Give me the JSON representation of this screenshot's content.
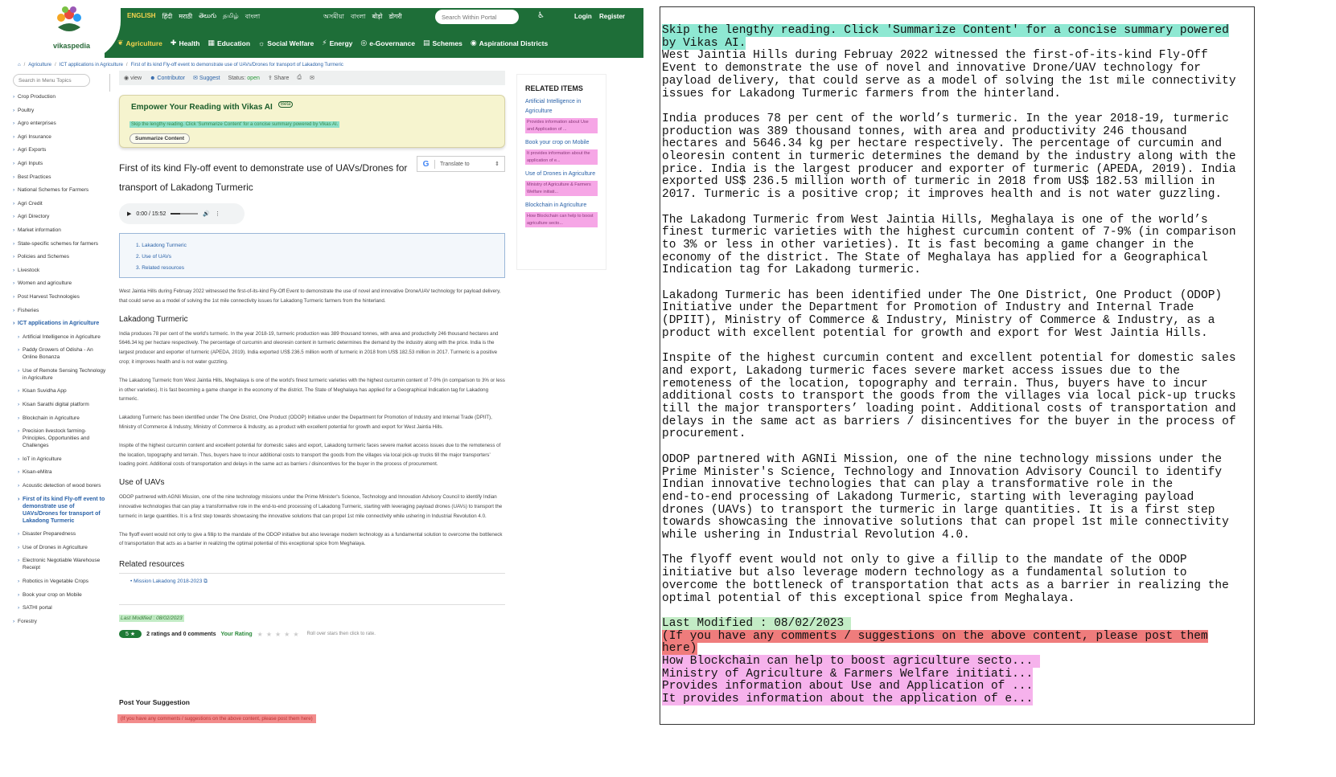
{
  "header": {
    "logo_text": "vikaspedia",
    "languages": [
      "ENGLISH",
      "हिंदी",
      "मराठी",
      "తెలుగు",
      "தமிழ்",
      "বাংলা"
    ],
    "languages2": [
      "অসমীয়া",
      "বাংলা",
      "बोड़ो",
      "डोगरी"
    ],
    "search_placeholder": "Search Within Portal",
    "login": "Login",
    "register": "Register",
    "nav": [
      {
        "label": "Agriculture",
        "icon": "plant-icon"
      },
      {
        "label": "Health",
        "icon": "health-icon"
      },
      {
        "label": "Education",
        "icon": "education-icon"
      },
      {
        "label": "Social Welfare",
        "icon": "welfare-icon"
      },
      {
        "label": "Energy",
        "icon": "energy-icon"
      },
      {
        "label": "e-Governance",
        "icon": "egov-icon"
      },
      {
        "label": "Schemes",
        "icon": "schemes-icon"
      },
      {
        "label": "Aspirational Districts",
        "icon": "location-icon"
      }
    ]
  },
  "breadcrumb": [
    "Agriculture",
    "ICT applications in Agriculture",
    "First of its kind Fly-off event to demonstrate use of UAVs/Drones for transport of Lakadong Turmeric"
  ],
  "sidebar": {
    "search_placeholder": "Search in Menu Topics",
    "items": [
      {
        "label": "Crop Production",
        "type": "top"
      },
      {
        "label": "Poultry",
        "type": "top"
      },
      {
        "label": "Agro enterprises",
        "type": "top"
      },
      {
        "label": "Agri Insurance",
        "type": "top"
      },
      {
        "label": "Agri Exports",
        "type": "top"
      },
      {
        "label": "Agri Inputs",
        "type": "top"
      },
      {
        "label": "Best Practices",
        "type": "top"
      },
      {
        "label": "National Schemes for Farmers",
        "type": "top"
      },
      {
        "label": "Agri Credit",
        "type": "top"
      },
      {
        "label": "Agri Directory",
        "type": "top"
      },
      {
        "label": "Market information",
        "type": "top"
      },
      {
        "label": "State-specific schemes for farmers",
        "type": "top"
      },
      {
        "label": "Policies and Schemes",
        "type": "top"
      },
      {
        "label": "Livestock",
        "type": "top"
      },
      {
        "label": "Women and agriculture",
        "type": "top"
      },
      {
        "label": "Post Harvest Technologies",
        "type": "top"
      },
      {
        "label": "Fisheries",
        "type": "top"
      },
      {
        "label": "ICT applications in Agriculture",
        "type": "active"
      },
      {
        "label": "Artificial Intelligence in Agriculture",
        "type": "sub"
      },
      {
        "label": "Paddy Growers of Odisha - An Online Bonanza",
        "type": "sub"
      },
      {
        "label": "Use of Remote Sensing Technology in Agriculture",
        "type": "sub"
      },
      {
        "label": "Kisan Suvidha App",
        "type": "sub"
      },
      {
        "label": "Kisan Sarathi digital platform",
        "type": "sub"
      },
      {
        "label": "Blockchain in Agriculture",
        "type": "sub"
      },
      {
        "label": "Precision livestock farming-Principles, Opportunities and Challenges",
        "type": "sub"
      },
      {
        "label": "IoT in Agriculture",
        "type": "sub"
      },
      {
        "label": "Kisan-eMitra",
        "type": "sub"
      },
      {
        "label": "Acoustic detection of wood borers",
        "type": "sub"
      },
      {
        "label": "First of its kind Fly-off event to demonstrate use of UAVs/Drones for transport of Lakadong Turmeric",
        "type": "current"
      },
      {
        "label": "Disaster Preparedness",
        "type": "sub"
      },
      {
        "label": "Use of Drones in Agriculture",
        "type": "sub"
      },
      {
        "label": "Electronic Negotiable Warehouse Receipt",
        "type": "sub"
      },
      {
        "label": "Robotics in Vegetable Crops",
        "type": "sub"
      },
      {
        "label": "Book your crop on Mobile",
        "type": "sub"
      },
      {
        "label": "SATHI portal",
        "type": "sub"
      },
      {
        "label": "Forestry",
        "type": "top"
      }
    ]
  },
  "action_bar": {
    "view": "view",
    "contributor": "Contributor",
    "suggest": "Suggest",
    "status_label": "Status:",
    "status_value": "open",
    "share": "Share"
  },
  "ai_box": {
    "title": "Empower Your Reading with Vikas AI",
    "beta": "Beta",
    "hint": "Skip the lengthy reading. Click 'Summarize Content' for a concise summary powered by Vikas AI.",
    "button": "Summarize Content"
  },
  "article": {
    "title": "First of its kind Fly-off event to demonstrate use of UAVs/Drones for transport of Lakadong Turmeric",
    "translate": "Translate to",
    "audio_time": "0:00 / 15:52",
    "toc": [
      "1. Lakadong Turmeric",
      "2. Use of UAVs",
      "3. Related resources"
    ],
    "intro": "West Jaintia Hills during Februay 2022 witnessed the first-of-its-kind Fly-Off Event to demonstrate the use of novel and innovative Drone/UAV technology for payload delivery, that could serve as a model of solving the 1st mile connectivity issues for Lakadong Turmeric farmers from the hinterland.",
    "h_turmeric": "Lakadong Turmeric",
    "p1": "India produces 78 per cent of the world’s turmeric. In the year 2018-19, turmeric production was 389 thousand tonnes, with area and productivity 246 thousand hectares and 5646.34 kg per hectare respectively. The percentage of curcumin and oleoresin content in turmeric determines the demand by the industry along with the price. India is the largest producer and exporter of turmeric (APEDA, 2019). India exported US$ 236.5 million worth of turmeric in 2018 from US$ 182.53 million in 2017. Turmeric is a positive crop; it improves health and is not water guzzling.",
    "p2": "The Lakadong Turmeric from West Jaintia Hills, Meghalaya is one of the world’s finest turmeric varieties with the highest curcumin content of 7-9% (in comparison to 3% or less in other varieties). It is fast becoming a game changer in the economy of the district. The State of Meghalaya has applied for a Geographical Indication tag for Lakadong turmeric.",
    "p3": "Lakadong Turmeric has been identified under The One District, One Product (ODOP) Initiative under the Department for Promotion of Industry and Internal Trade (DPIIT), Ministry of Commerce & Industry, Ministry of Commerce & Industry, as a product with excellent potential for growth and export for West Jaintia Hills.",
    "p4": "Inspite of the highest curcumin content and excellent potential for domestic sales and export, Lakadong turmeric faces severe market access issues due to the remoteness of the location, topography and terrain. Thus, buyers have to incur additional costs to transport the goods from the villages via local pick-up trucks till the major transporters’ loading point. Additional costs of transportation and delays in the same act as barriers / disincentives for the buyer in the process of procurement.",
    "h_uavs": "Use of UAVs",
    "p5": "ODOP partnered with AGNIi Mission, one of the nine technology missions under the Prime Minister's Science, Technology and Innovation Advisory Council to identify Indian innovative technologies that can play a transformative role in the end-to-end processing of Lakadong Turmeric, starting with leveraging payload drones (UAVs) to transport the turmeric in large quantities. It is a first step towards showcasing the innovative solutions that can propel 1st mile connectivity while ushering in Industrial Revolution 4.0.",
    "p6": "The flyoff event would not only to give a fillip to the mandate of the ODOP initiative but also leverage modern technology as a fundamental solution to overcome the bottleneck of transportation that acts as a barrier in realizing the optimal potential of this exceptional spice from Meghalaya.",
    "h_related": "Related resources",
    "related_link": "Mission Lakadong 2018-2023",
    "last_modified": "Last Modified : 08/02/2023",
    "rating_badge": "5 ★",
    "rating_text": "2 ratings and 0 comments",
    "your_rating": "Your Rating",
    "stars": "★★★★★",
    "rate_hint": "Roll over stars then click to rate.",
    "post_heading": "Post Your Suggestion",
    "post_hint": "(If you have any comments / suggestions on the above content, please post them here)"
  },
  "related_items": {
    "heading": "RELATED ITEMS",
    "items": [
      {
        "link": "Artificial Intelligence in Agriculture",
        "desc": "Provides information about Use and Application of ..."
      },
      {
        "link": "Book your crop on Mobile",
        "desc": "It provides information about the application of e..."
      },
      {
        "link": "Use of Drones in Agriculture",
        "desc": "Ministry of Agriculture & Farmers Welfare initiati..."
      },
      {
        "link": "Blockchain in Agriculture",
        "desc": "How Blockchain can help to boost agriculture secto..."
      }
    ]
  },
  "panel": {
    "hint": "Skip the lengthy reading. Click 'Summarize Content' for a concise summary powered\nby Vikas AI.",
    "intro": "West Jaintia Hills during Februay 2022 witnessed the first-of-its-kind Fly-Off\nEvent to demonstrate the use of novel and innovative Drone/UAV technology for\npayload delivery, that could serve as a model of solving the 1st mile connectivity\nissues for Lakadong Turmeric farmers from the hinterland.",
    "p1": "India produces 78 per cent of the world’s turmeric. In the year 2018-19, turmeric\nproduction was 389 thousand tonnes, with area and productivity 246 thousand\nhectares and 5646.34 kg per hectare respectively. The percentage of curcumin and\noleoresin content in turmeric determines the demand by the industry along with the\nprice. India is the largest producer and exporter of turmeric (APEDA, 2019). India\nexported US$ 236.5 million worth of turmeric in 2018 from US$ 182.53 million in\n2017. Turmeric is a positive crop; it improves health and is not water guzzling.",
    "p2": "The Lakadong Turmeric from West Jaintia Hills, Meghalaya is one of the world’s\nfinest turmeric varieties with the highest curcumin content of 7-9% (in comparison\nto 3% or less in other varieties). It is fast becoming a game changer in the\neconomy of the district. The State of Meghalaya has applied for a Geographical\nIndication tag for Lakadong turmeric.",
    "p3": "Lakadong Turmeric has been identified under The One District, One Product (ODOP)\nInitiative under the Department for Promotion of Industry and Internal Trade\n(DPIIT), Ministry of Commerce & Industry, Ministry of Commerce & Industry, as a\nproduct with excellent potential for growth and export for West Jaintia Hills.",
    "p4": "Inspite of the highest curcumin content and excellent potential for domestic sales\nand export, Lakadong turmeric faces severe market access issues due to the\nremoteness of the location, topography and terrain. Thus, buyers have to incur\nadditional costs to transport the goods from the villages via local pick-up trucks\ntill the major transporters’ loading point. Additional costs of transportation and\ndelays in the same act as barriers / disincentives for the buyer in the process of\nprocurement.",
    "p5": "ODOP partnered with AGNIi Mission, one of the nine technology missions under the\nPrime Minister's Science, Technology and Innovation Advisory Council to identify\nIndian innovative technologies that can play a transformative role in the\nend-to-end processing of Lakadong Turmeric, starting with leveraging payload\ndrones (UAVs) to transport the turmeric in large quantities. It is a first step\ntowards showcasing the innovative solutions that can propel 1st mile connectivity\nwhile ushering in Industrial Revolution 4.0.",
    "p6": "The flyoff event would not only to give a fillip to the mandate of the ODOP\ninitiative but also leverage modern technology as a fundamental solution to\novercome the bottleneck of transportation that acts as a barrier in realizing the\noptimal potential of this exceptional spice from Meghalaya.",
    "last_modified": "Last Modified : 08/02/2023 ",
    "post_hint": "(If you have any comments / suggestions on the above content, please post them\nhere)",
    "rel1": "How Blockchain can help to boost agriculture secto... ",
    "rel2": "Ministry of Agriculture & Farmers Welfare initiati...",
    "rel3": "Provides information about Use and Application of ...",
    "rel4": "It provides information about the application of e..."
  }
}
